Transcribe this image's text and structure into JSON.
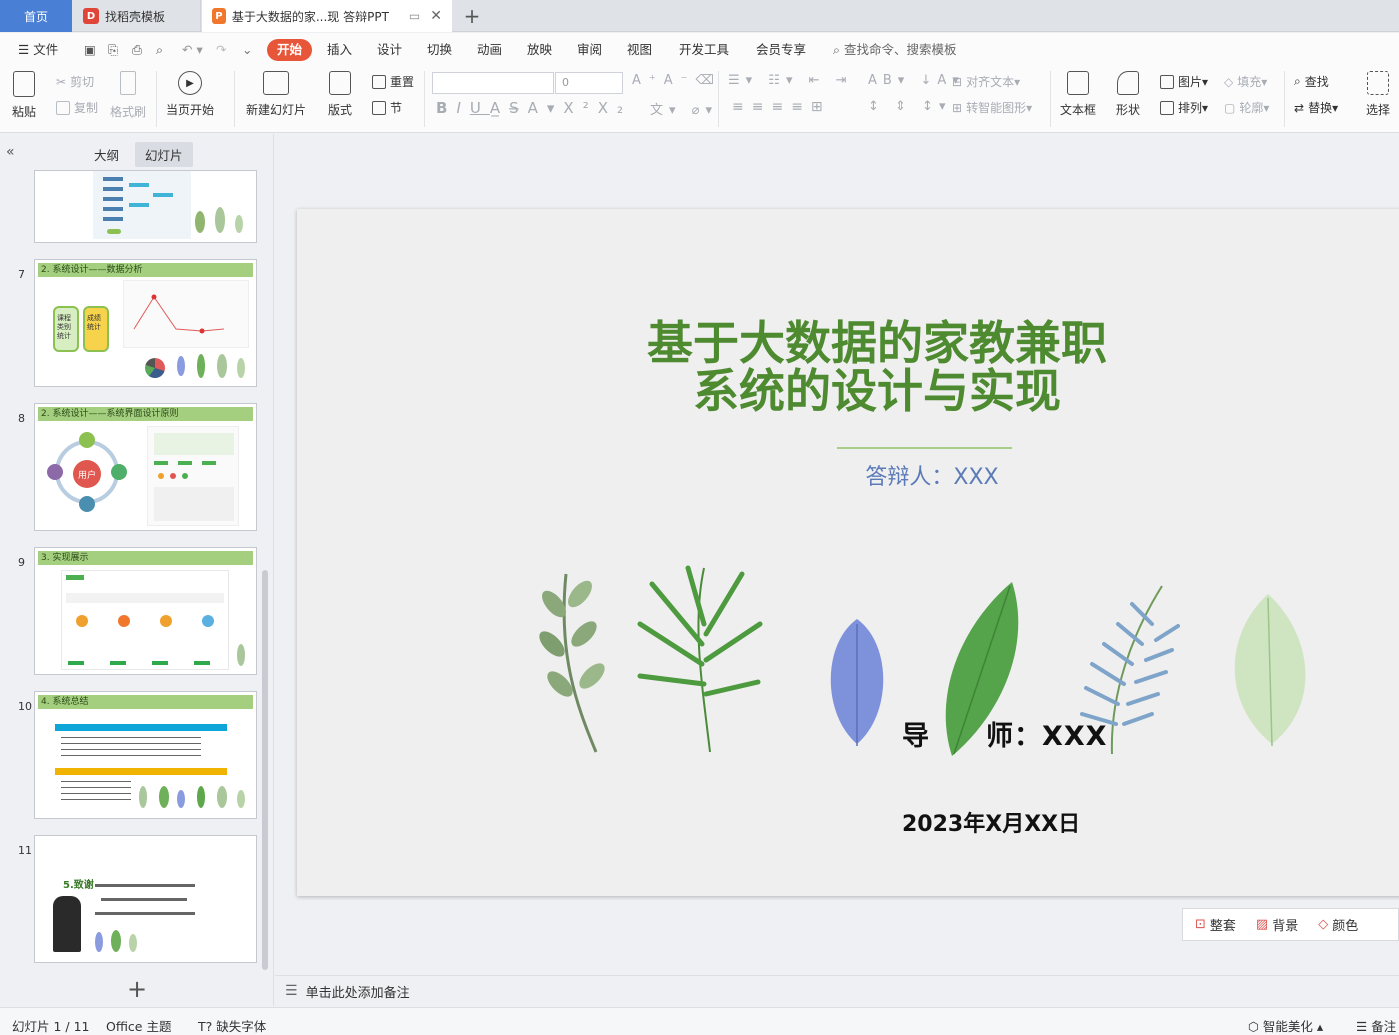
{
  "tabs": {
    "home": "首页",
    "templates": "找稻壳模板",
    "document": "基于大数据的家...现 答辩PPT"
  },
  "menu": {
    "file": "文件",
    "search_placeholder": "查找命令、搜索模板",
    "items": [
      "开始",
      "插入",
      "设计",
      "切换",
      "动画",
      "放映",
      "审阅",
      "视图",
      "开发工具",
      "会员专享"
    ]
  },
  "ribbon": {
    "paste": "粘贴",
    "cut": "剪切",
    "copy": "复制",
    "format_painter": "格式刷",
    "from_current": "当页开始",
    "new_slide": "新建幻灯片",
    "layout": "版式",
    "reset": "重置",
    "section": "节",
    "font_size": "0",
    "align_text": "对齐文本",
    "smart_shape": "转智能图形",
    "textbox": "文本框",
    "shape": "形状",
    "picture": "图片",
    "arrange": "排列",
    "fill": "填充",
    "outline": "轮廓",
    "find": "查找",
    "replace": "替换",
    "select": "选择"
  },
  "panel": {
    "outline_tab": "大纲",
    "slides_tab": "幻灯片"
  },
  "thumbnails": [
    {
      "num": "7",
      "heading": "2. 系统设计——数据分析",
      "left_top": "课程类别统计",
      "left_bottom": "成绩统计"
    },
    {
      "num": "8",
      "heading": "2. 系统设计——系统界面设计原则",
      "center": "用户"
    },
    {
      "num": "9",
      "heading": "3. 实现展示"
    },
    {
      "num": "10",
      "heading": "4. 系统总结"
    },
    {
      "num": "11",
      "heading": "5.致谢"
    }
  ],
  "slide": {
    "title_line1": "基于大数据的家教兼职",
    "title_line2": "系统的设计与实现",
    "defender": "答辩人：XXX",
    "mentor": "导　　师：XXX",
    "date": "2023年X月XX日"
  },
  "floatbar": {
    "tidy": "整套",
    "background": "背景",
    "color": "颜色"
  },
  "notes": {
    "placeholder": "单击此处添加备注"
  },
  "status": {
    "slide_count": "幻灯片 1 / 11",
    "theme": "Office 主题",
    "missing_font": "缺失字体",
    "beautify": "智能美化",
    "notes": "备注"
  },
  "colors": {
    "accent": "#e8563a",
    "home_tab": "#4a7fd6",
    "title_green": "#4e8a2f",
    "defender_blue": "#5b7ab8"
  }
}
